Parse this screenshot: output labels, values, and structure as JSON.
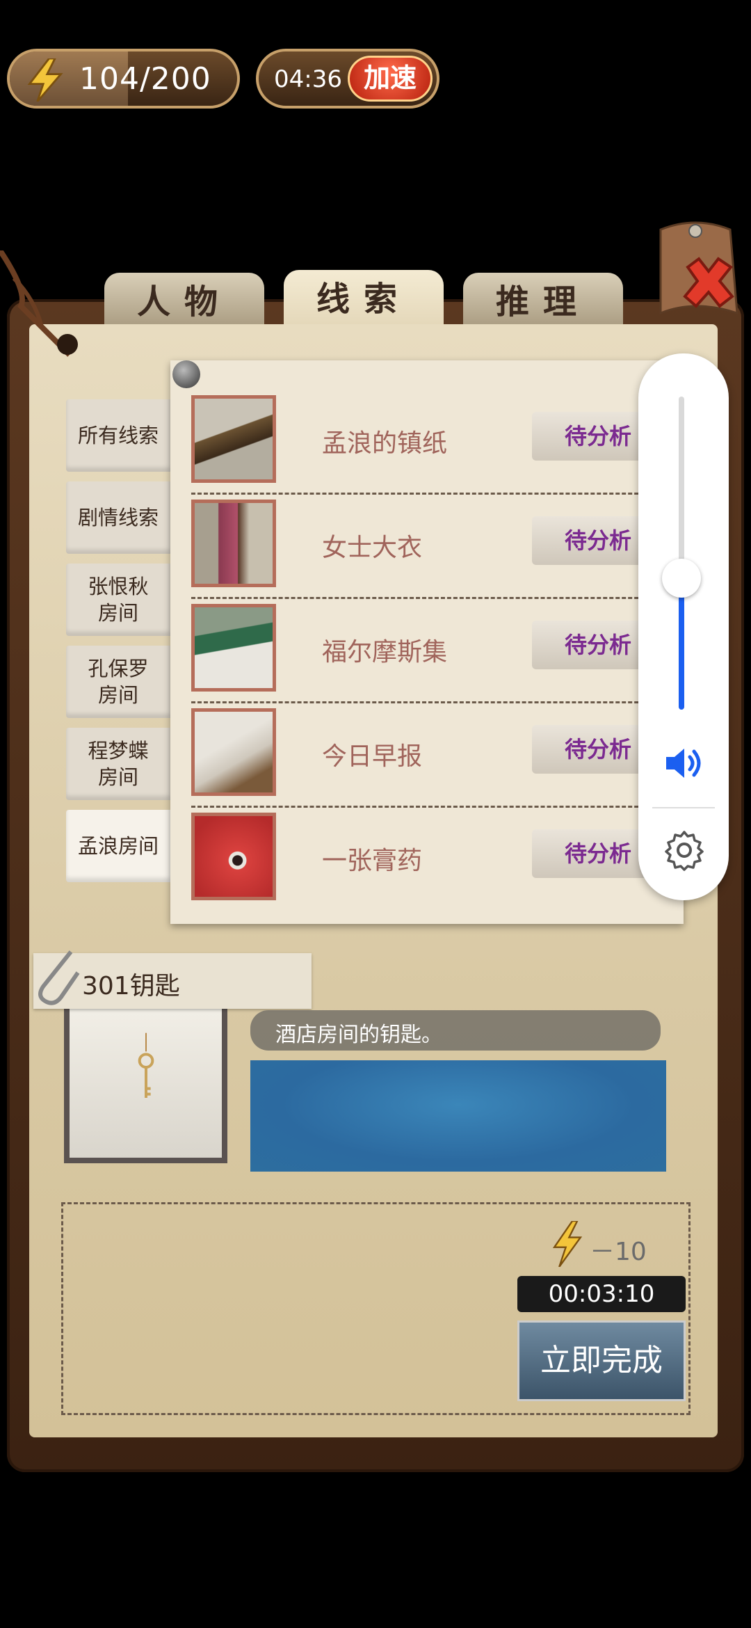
{
  "hud": {
    "energy": "104/200",
    "energy_current": 104,
    "energy_max": 200,
    "timer": "04:36",
    "speed_up": "加速"
  },
  "tabs": [
    {
      "label": "人物",
      "active": false
    },
    {
      "label": "线索",
      "active": true
    },
    {
      "label": "推理",
      "active": false
    }
  ],
  "categories": [
    {
      "label": "所有线索"
    },
    {
      "label": "剧情线索"
    },
    {
      "label": "张恨秋房间"
    },
    {
      "label": "孔保罗房间"
    },
    {
      "label": "程梦蝶房间"
    },
    {
      "label": "孟浪房间",
      "active": true
    }
  ],
  "clues": [
    {
      "name": "孟浪的镇纸",
      "action": "待分析"
    },
    {
      "name": "女士大衣",
      "action": "待分析"
    },
    {
      "name": "福尔摩斯集",
      "action": "待分析"
    },
    {
      "name": "今日早报",
      "action": "待分析"
    },
    {
      "name": "一张膏药",
      "action": "待分析"
    }
  ],
  "selected_item": {
    "name": "301钥匙",
    "description": "酒店房间的钥匙。"
  },
  "analysis": {
    "cost": "－10",
    "duration": "00:03:10",
    "finish_label": "立即完成"
  },
  "volume_overlay": {
    "level": 0.42
  },
  "colors": {
    "paper": "#e8dcc0",
    "clue_name": "#a0645b",
    "action_text": "#7b2a90",
    "volume_fill": "#1b5ff0"
  }
}
